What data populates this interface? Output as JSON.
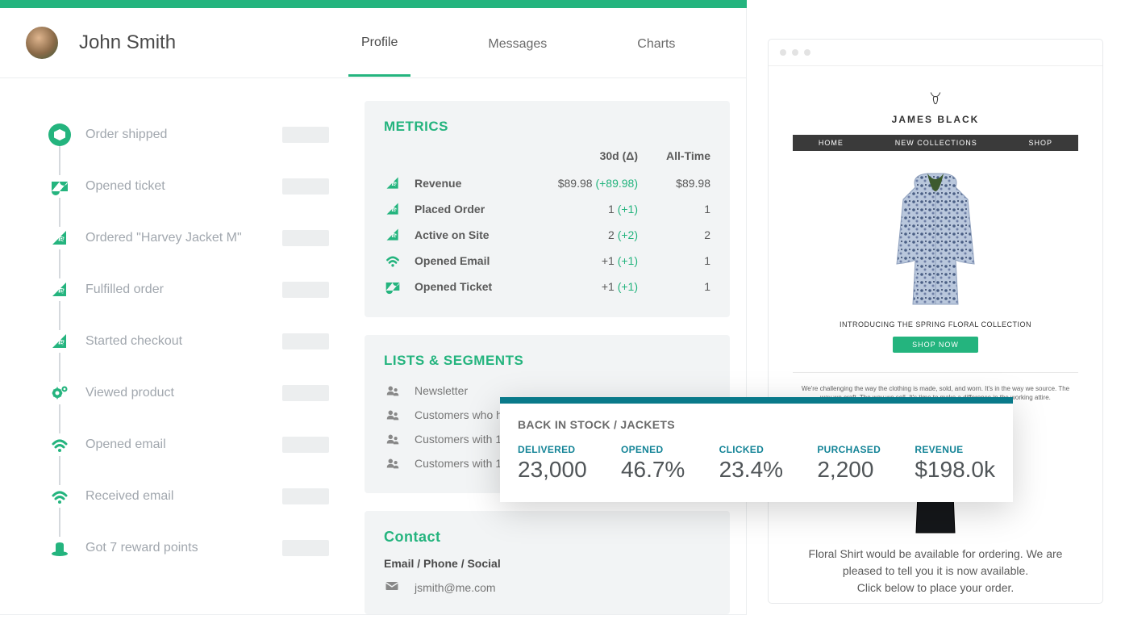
{
  "header": {
    "username": "John Smith",
    "tabs": [
      "Profile",
      "Messages",
      "Charts"
    ],
    "active_tab": "Profile"
  },
  "timeline": [
    {
      "icon": "box-icon",
      "label": "Order shipped"
    },
    {
      "icon": "zendesk-icon",
      "label": "Opened ticket"
    },
    {
      "icon": "commerce-icon",
      "label": "Ordered \"Harvey Jacket M\""
    },
    {
      "icon": "commerce-icon",
      "label": "Fulfilled order"
    },
    {
      "icon": "commerce-icon",
      "label": "Started checkout"
    },
    {
      "icon": "gear-icon",
      "label": "Viewed product"
    },
    {
      "icon": "wifi-icon",
      "label": "Opened email"
    },
    {
      "icon": "wifi-icon",
      "label": "Received email"
    },
    {
      "icon": "hat-icon",
      "label": "Got 7 reward points"
    }
  ],
  "metrics_card": {
    "title": "METRICS",
    "col_30d": "30d (Δ)",
    "col_alltime": "All-Time",
    "rows": [
      {
        "icon": "commerce-icon",
        "label": "Revenue",
        "d30": "$89.98 ",
        "delta": "(+89.98)",
        "alltime": "$89.98"
      },
      {
        "icon": "commerce-icon",
        "label": "Placed Order",
        "d30": "1 ",
        "delta": "(+1)",
        "alltime": "1"
      },
      {
        "icon": "commerce-icon",
        "label": "Active on Site",
        "d30": "2 ",
        "delta": "(+2)",
        "alltime": "2"
      },
      {
        "icon": "wifi-icon",
        "label": "Opened Email",
        "d30": "+1 ",
        "delta": "(+1)",
        "alltime": "1"
      },
      {
        "icon": "zendesk-icon",
        "label": "Opened Ticket",
        "d30": "+1 ",
        "delta": "(+1)",
        "alltime": "1"
      }
    ]
  },
  "lists_card": {
    "title": "LISTS & SEGMENTS",
    "rows": [
      "Newsletter",
      "Customers who have spent $50-$100",
      "Customers with 1",
      "Customers with 1"
    ]
  },
  "contact_card": {
    "title": "Contact",
    "subheading": "Email / Phone / Social",
    "email": "jsmith@me.com"
  },
  "email_preview": {
    "brand": "JAMES BLACK",
    "nav": [
      "HOME",
      "NEW COLLECTIONS",
      "SHOP"
    ],
    "intro": "INTRODUCING THE SPRING FLORAL COLLECTION",
    "cta": "SHOP NOW",
    "blurb": "We're challenging the way the clothing is made, sold, and worn. It's in the way we source. The way we craft. The way we sell. It's time to make a difference in the working attire.",
    "restock_line1": "Floral Shirt would be available for ordering. We are pleased to tell you it is now available.",
    "restock_line2": "Click below to place your order."
  },
  "stats": {
    "title": "BACK IN STOCK / JACKETS",
    "items": [
      {
        "label": "DELIVERED",
        "value": "23,000"
      },
      {
        "label": "OPENED",
        "value": "46.7%"
      },
      {
        "label": "CLICKED",
        "value": "23.4%"
      },
      {
        "label": "PURCHASED",
        "value": "2,200"
      },
      {
        "label": "REVENUE",
        "value": "$198.0k"
      }
    ]
  }
}
